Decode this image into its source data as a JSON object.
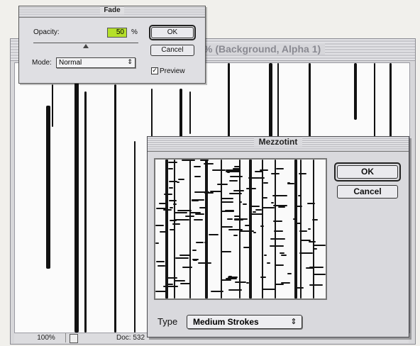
{
  "document_window": {
    "title": "% (Background, Alpha 1)",
    "status": {
      "zoom": "100%",
      "doc_info": "Doc: 532"
    }
  },
  "fade_dialog": {
    "title": "Fade",
    "opacity_label": "Opacity:",
    "opacity_value": "50",
    "opacity_unit": "%",
    "opacity_slider_fraction": 0.5,
    "mode_label": "Mode:",
    "mode_value": "Normal",
    "ok_label": "OK",
    "cancel_label": "Cancel",
    "preview_label": "Preview",
    "preview_checked": true
  },
  "mezzotint_dialog": {
    "title": "Mezzotint",
    "ok_label": "OK",
    "cancel_label": "Cancel",
    "type_label": "Type",
    "type_value": "Medium Strokes"
  },
  "icons": {
    "checkmark": "checkmark-icon",
    "select_arrows": "updown-arrows-icon",
    "document": "document-icon"
  },
  "colors": {
    "opacity_highlight": "#b5e02a",
    "dialog_bg": "#dfdfe3",
    "canvas_bg": "#fbfbfb"
  }
}
